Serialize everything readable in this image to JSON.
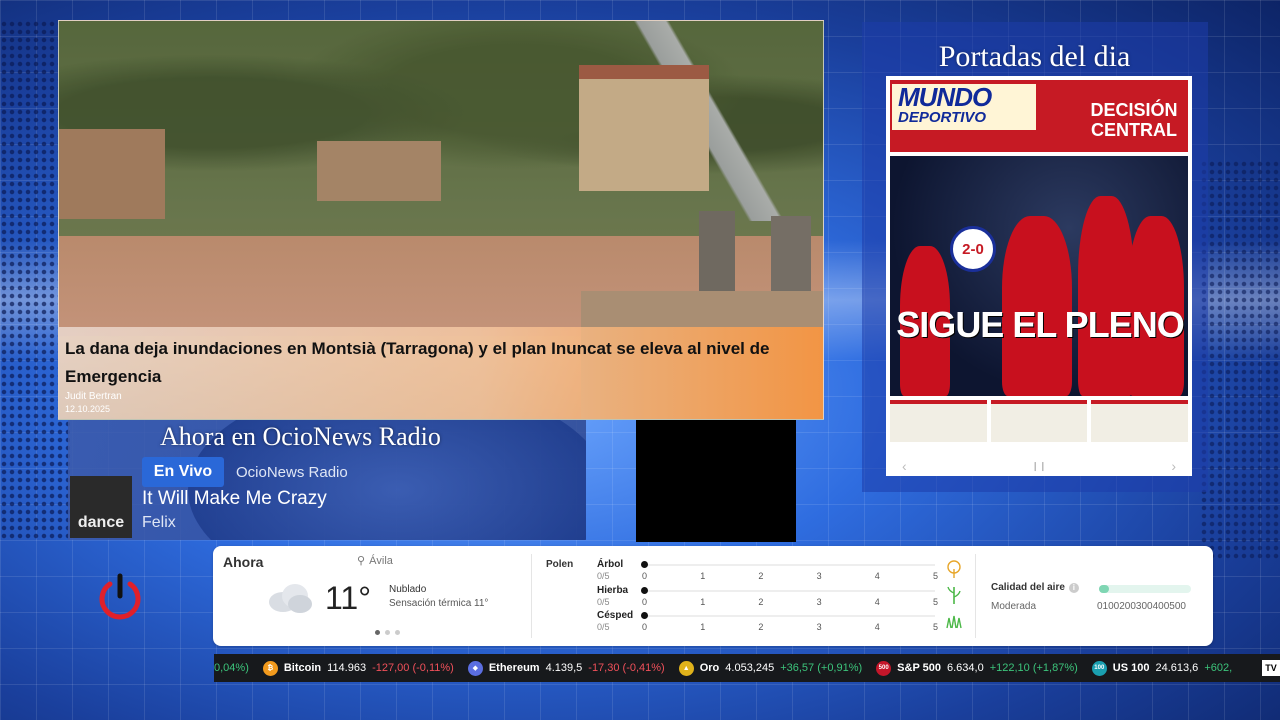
{
  "news": {
    "headline": "La dana deja inundaciones en Montsià (Tarragona) y el plan Inuncat se eleva al nivel de Emergencia",
    "author": "Judit Bertran",
    "date": "12.10.2025"
  },
  "portadas": {
    "title": "Portadas del dia",
    "cover": {
      "logo_line1": "MUNDO",
      "logo_line2": "DEPORTIVO",
      "headline_top": "DECISIÓN CENTRAL",
      "score": "2-0",
      "main_headline": "SIGUE EL PLENO"
    }
  },
  "radio": {
    "title": "Ahora en OcioNews Radio",
    "badge": "En Vivo",
    "station": "OcioNews Radio",
    "cover_text": "dance",
    "song": "It Will Make Me Crazy",
    "artist": "Felix"
  },
  "weather": {
    "now_label": "Ahora",
    "location": "Ávila",
    "temperature": "11°",
    "condition": "Nublado",
    "feels_like": "Sensación térmica 11°",
    "carousel_page": 1,
    "carousel_total": 3,
    "polen_label": "Polen",
    "pollen": [
      {
        "name": "Árbol",
        "value": "0/5",
        "level": 0,
        "icon": "tree-icon"
      },
      {
        "name": "Hierba",
        "value": "0/5",
        "level": 0,
        "icon": "grass-icon"
      },
      {
        "name": "Césped",
        "value": "0/5",
        "level": 0,
        "icon": "lawn-icon"
      }
    ],
    "pollen_ticks": [
      "0",
      "1",
      "2",
      "3",
      "4",
      "5"
    ],
    "air_label": "Calidad del aire",
    "air_level": "Moderada",
    "air_scale": "0100200300400500"
  },
  "ticker": [
    {
      "prefix": "0,04%)",
      "name": "",
      "price": "",
      "change": "",
      "dir": "pos",
      "icon": ""
    },
    {
      "name": "Bitcoin",
      "price": "114.963",
      "change": "-127,00 (-0,11%)",
      "dir": "neg",
      "icon": "bitcoin-icon",
      "color": "#f29a1d",
      "glyph": "₿"
    },
    {
      "name": "Ethereum",
      "price": "4.139,5",
      "change": "-17,30 (-0,41%)",
      "dir": "neg",
      "icon": "ethereum-icon",
      "color": "#5b6ee1",
      "glyph": "◆"
    },
    {
      "name": "Oro",
      "price": "4.053,245",
      "change": "+36,57 (+0,91%)",
      "dir": "pos",
      "icon": "gold-icon",
      "color": "#e0b21b",
      "glyph": "▲"
    },
    {
      "name": "S&P 500",
      "price": "6.634,0",
      "change": "+122,10 (+1,87%)",
      "dir": "pos",
      "icon": "sp500-icon",
      "color": "#c4162a",
      "glyph": "500"
    },
    {
      "name": "US 100",
      "price": "24.613,6",
      "change": "+602,",
      "dir": "pos",
      "icon": "us100-icon",
      "color": "#1a9fb0",
      "glyph": "100"
    }
  ],
  "ticker_logo": "TV",
  "colors": {
    "live_badge": "#2a68d8",
    "power_red": "#e0202a",
    "md_red": "#c61a24"
  }
}
